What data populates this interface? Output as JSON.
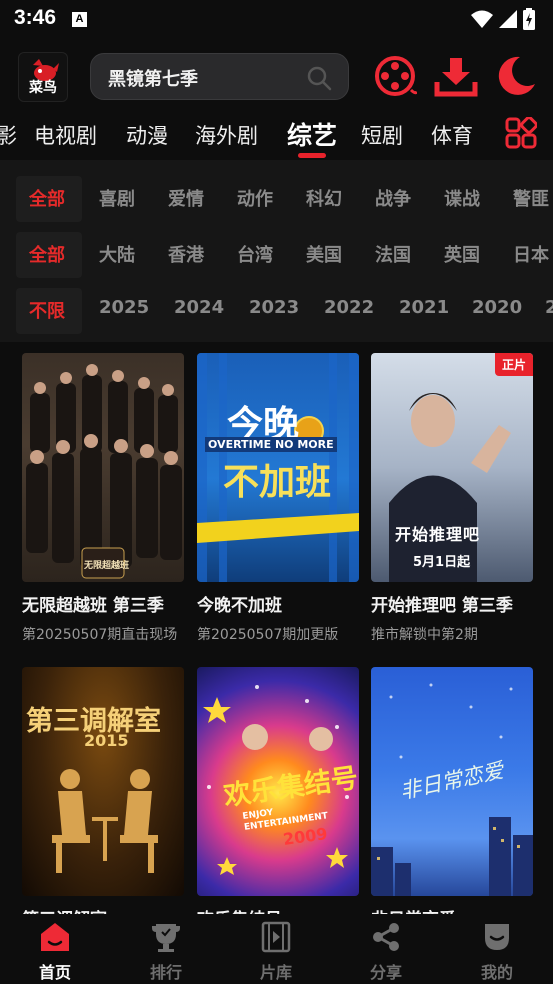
{
  "status": {
    "time": "3:46",
    "a_icon": "A"
  },
  "header": {
    "logo_label": "菜鸟",
    "search_value": "黑镜第七季",
    "icons": [
      "film-reel-icon",
      "download-icon",
      "moon-icon"
    ]
  },
  "tabs": {
    "partial": "影",
    "items": [
      "电视剧",
      "动漫",
      "海外剧",
      "综艺",
      "短剧",
      "体育"
    ],
    "active": "综艺"
  },
  "filters": {
    "genre": [
      "全部",
      "喜剧",
      "爱情",
      "动作",
      "科幻",
      "战争",
      "谍战",
      "警匪"
    ],
    "region": [
      "全部",
      "大陆",
      "香港",
      "台湾",
      "美国",
      "法国",
      "英国",
      "日本"
    ],
    "year": [
      "不限",
      "2025",
      "2024",
      "2023",
      "2022",
      "2021",
      "2020",
      "2"
    ]
  },
  "cards": [
    {
      "title": "无限超越班 第三季",
      "sub": "第20250507期直击现场",
      "badge": ""
    },
    {
      "title": "今晚不加班",
      "sub": "第20250507期加更版",
      "badge": ""
    },
    {
      "title": "开始推理吧 第三季",
      "sub": "推市解锁中第2期",
      "badge": "正片"
    },
    {
      "title": "第三调解室",
      "sub": "",
      "badge": ""
    },
    {
      "title": "欢乐集结号",
      "sub": "",
      "badge": ""
    },
    {
      "title": "非日常恋爱",
      "sub": "",
      "badge": ""
    }
  ],
  "posters": {
    "p1_small": "无限超越班",
    "p2_line1": "今晚",
    "p2_overtime": "OVERTIME NO MORE",
    "p2_line2": "不加班",
    "p3_title": "开始推理吧",
    "p3_date": "5月1日起",
    "p4_title": "第三调解室",
    "p4_year": "2015",
    "p5_title": "欢乐集结号",
    "p5_en": "ENJOY ENTERTAINMENT",
    "p5_year": "2009",
    "p6_title": "非日常恋爱"
  },
  "bottom_nav": [
    {
      "label": "首页",
      "icon": "home-icon",
      "active": true
    },
    {
      "label": "排行",
      "icon": "trophy-icon",
      "active": false
    },
    {
      "label": "片库",
      "icon": "film-library-icon",
      "active": false
    },
    {
      "label": "分享",
      "icon": "share-icon",
      "active": false
    },
    {
      "label": "我的",
      "icon": "profile-icon",
      "active": false
    }
  ],
  "colors": {
    "accent": "#e8222b",
    "background": "#0d0d0d",
    "panel": "#161616",
    "muted": "#8a8a8a"
  }
}
